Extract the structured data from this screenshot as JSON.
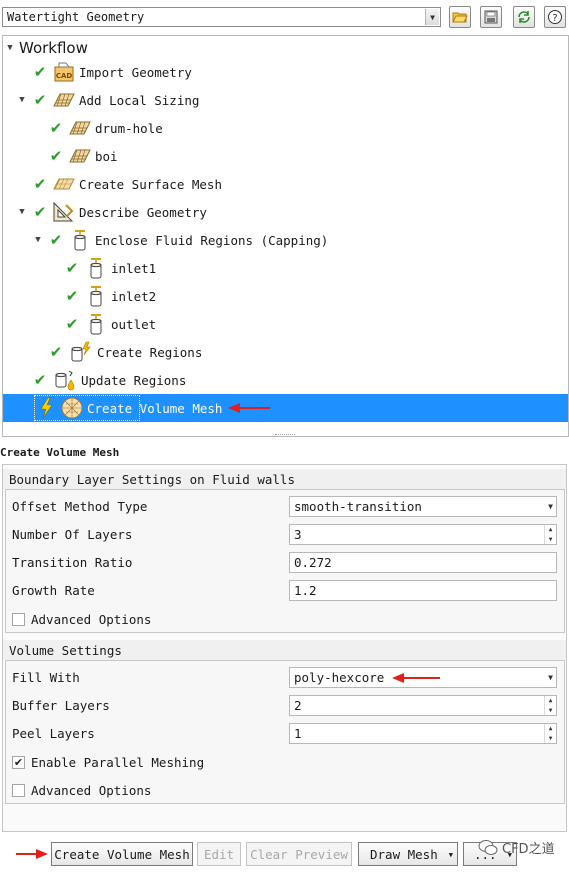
{
  "toolbar": {
    "mode_value": "Watertight Geometry",
    "icons": [
      "open-folder-icon",
      "save-icon",
      "refresh-icon",
      "help-icon"
    ]
  },
  "workflow": {
    "title": "Workflow",
    "items": [
      {
        "label": "Import Geometry",
        "icon": "cad-import-icon"
      },
      {
        "label": "Add Local Sizing",
        "icon": "mesh-grid-icon"
      },
      {
        "label": "drum-hole",
        "icon": "mesh-grid-icon"
      },
      {
        "label": "boi",
        "icon": "mesh-grid-icon"
      },
      {
        "label": "Create Surface Mesh",
        "icon": "surface-mesh-icon"
      },
      {
        "label": "Describe Geometry",
        "icon": "geometry-ruler-icon"
      },
      {
        "label": "Enclose Fluid Regions (Capping)",
        "icon": "capping-icon"
      },
      {
        "label": "inlet1",
        "icon": "capping-icon"
      },
      {
        "label": "inlet2",
        "icon": "capping-icon"
      },
      {
        "label": "outlet",
        "icon": "capping-icon"
      },
      {
        "label": "Create Regions",
        "icon": "regions-icon"
      },
      {
        "label": "Update Regions",
        "icon": "update-regions-icon"
      },
      {
        "label": "Create Volume Mesh",
        "icon": "volume-mesh-icon"
      }
    ]
  },
  "panel": {
    "title": "Create Volume Mesh",
    "boundary_group": {
      "title": "Boundary Layer Settings on Fluid walls",
      "offset_method": {
        "label": "Offset Method Type",
        "value": "smooth-transition"
      },
      "num_layers": {
        "label": "Number Of Layers",
        "value": "3"
      },
      "transition_ratio": {
        "label": "Transition Ratio",
        "value": "0.272"
      },
      "growth_rate": {
        "label": "Growth Rate",
        "value": "1.2"
      },
      "advanced": {
        "label": "Advanced Options",
        "checked": false
      }
    },
    "volume_group": {
      "title": "Volume Settings",
      "fill_with": {
        "label": "Fill With",
        "value": "poly-hexcore"
      },
      "buffer_layers": {
        "label": "Buffer Layers",
        "value": "2"
      },
      "peel_layers": {
        "label": "Peel Layers",
        "value": "1"
      },
      "parallel": {
        "label": "Enable Parallel Meshing",
        "checked": true
      },
      "advanced": {
        "label": "Advanced Options",
        "checked": false
      }
    }
  },
  "buttons": {
    "create": "Create Volume Mesh",
    "edit": "Edit",
    "clear_preview": "Clear Preview",
    "draw_mesh": "Draw Mesh",
    "more": "..."
  },
  "watermark": "CFD之道",
  "colors": {
    "selection": "#1e90ff",
    "check": "#2e9b2e",
    "annotation_arrow": "#e0201a"
  }
}
